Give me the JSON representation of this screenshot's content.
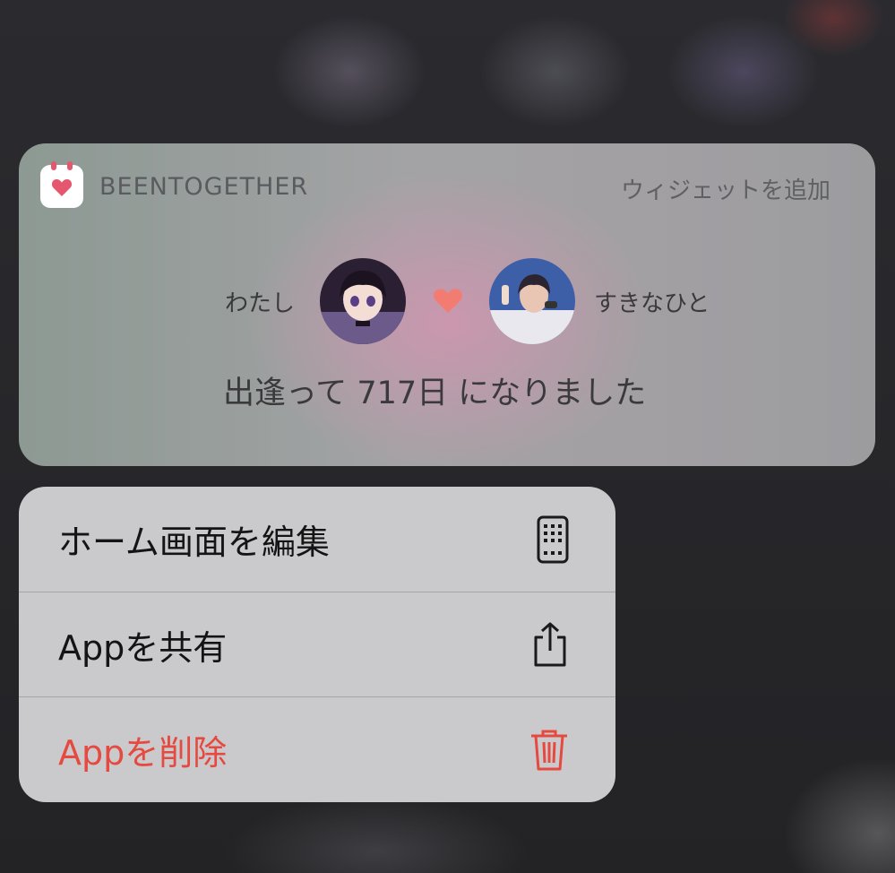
{
  "widget": {
    "app_name": "BEENTOGETHER",
    "add_widget_label": "ウィジェットを追加",
    "left_person_label": "わたし",
    "right_person_label": "すきなひと",
    "days_text": "出逢って 717日 になりました",
    "icons": {
      "app": "heart-calendar-icon",
      "between": "heart-icon"
    },
    "colors": {
      "heart": "#f27b72",
      "app_accent": "#e5566f"
    }
  },
  "menu": {
    "items": [
      {
        "label": "ホーム画面を編集",
        "icon": "phone-grid-icon",
        "destructive": false
      },
      {
        "label": "Appを共有",
        "icon": "share-icon",
        "destructive": false
      },
      {
        "label": "Appを削除",
        "icon": "trash-icon",
        "destructive": true
      }
    ],
    "colors": {
      "destructive": "#e5493f"
    }
  }
}
